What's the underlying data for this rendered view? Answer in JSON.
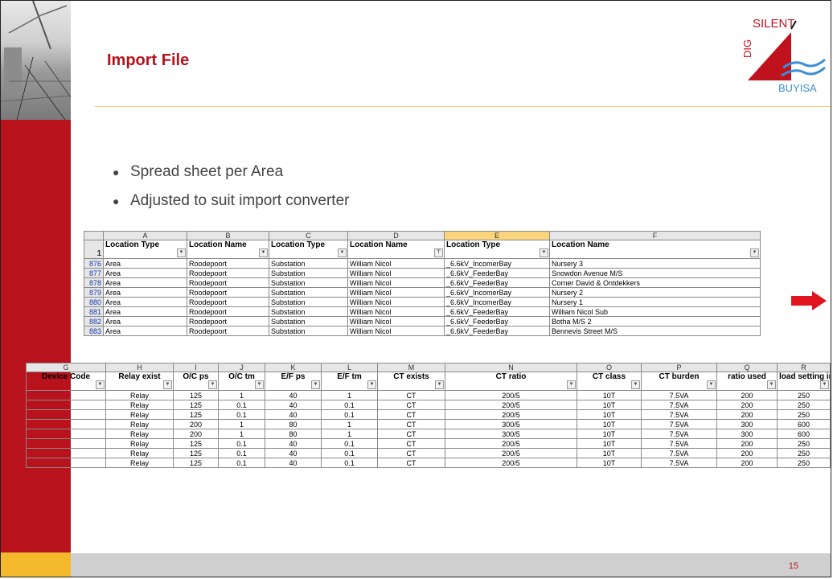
{
  "slide": {
    "title": "Import File",
    "page_number": "15",
    "bullets": [
      "Spread sheet per Area",
      "Adjusted to suit import converter"
    ]
  },
  "logo": {
    "top_text": "SILENT",
    "side_text": "DIG",
    "bottom_text": "BUYISA"
  },
  "sheet1": {
    "columns": [
      "A",
      "B",
      "C",
      "D",
      "E",
      "F"
    ],
    "header_row_number": "1",
    "headers": [
      "Location Type",
      "Location Name",
      "Location Type",
      "Location Name",
      "Location Type",
      "Location Name"
    ],
    "rows": [
      {
        "n": "876",
        "cells": [
          "Area",
          "Roodepoort",
          "Substation",
          "William Nicol",
          "_6.6kV_IncomerBay",
          "Nursery 3"
        ]
      },
      {
        "n": "877",
        "cells": [
          "Area",
          "Roodepoort",
          "Substation",
          "William Nicol",
          "_6.6kV_FeederBay",
          "Snowdon Avenue M/S"
        ]
      },
      {
        "n": "878",
        "cells": [
          "Area",
          "Roodepoort",
          "Substation",
          "William Nicol",
          "_6.6kV_FeederBay",
          "Corner David & Ontdekkers"
        ]
      },
      {
        "n": "879",
        "cells": [
          "Area",
          "Roodepoort",
          "Substation",
          "William Nicol",
          "_6.6kV_IncomerBay",
          "Nursery 2"
        ]
      },
      {
        "n": "880",
        "cells": [
          "Area",
          "Roodepoort",
          "Substation",
          "William Nicol",
          "_6.6kV_IncomerBay",
          "Nursery 1"
        ]
      },
      {
        "n": "881",
        "cells": [
          "Area",
          "Roodepoort",
          "Substation",
          "William Nicol",
          "_6.6kV_FeederBay",
          "William Nicol Sub"
        ]
      },
      {
        "n": "882",
        "cells": [
          "Area",
          "Roodepoort",
          "Substation",
          "William Nicol",
          "_6.6kV_FeederBay",
          "Botha M/S 2"
        ]
      },
      {
        "n": "883",
        "cells": [
          "Area",
          "Roodepoort",
          "Substation",
          "William Nicol",
          "_6.6kV_FeederBay",
          "Bennevis Street M/S"
        ]
      }
    ]
  },
  "sheet2": {
    "columns": [
      "G",
      "H",
      "I",
      "J",
      "K",
      "L",
      "M",
      "N",
      "O",
      "P",
      "Q",
      "R"
    ],
    "headers": [
      "Device Code",
      "Relay exist",
      "O/C ps",
      "O/C tm",
      "E/F ps",
      "E/F tm",
      "CT exists",
      "CT ratio",
      "CT class",
      "CT burden",
      "ratio used",
      "load setting in Amps"
    ],
    "rows": [
      [
        "",
        "Relay",
        "125",
        "1",
        "40",
        "1",
        "CT",
        "200/5",
        "10T",
        "7.5VA",
        "200",
        "250"
      ],
      [
        "",
        "Relay",
        "125",
        "0.1",
        "40",
        "0.1",
        "CT",
        "200/5",
        "10T",
        "7.5VA",
        "200",
        "250"
      ],
      [
        "",
        "Relay",
        "125",
        "0.1",
        "40",
        "0.1",
        "CT",
        "200/5",
        "10T",
        "7.5VA",
        "200",
        "250"
      ],
      [
        "",
        "Relay",
        "200",
        "1",
        "80",
        "1",
        "CT",
        "300/5",
        "10T",
        "7.5VA",
        "300",
        "600"
      ],
      [
        "",
        "Relay",
        "200",
        "1",
        "80",
        "1",
        "CT",
        "300/5",
        "10T",
        "7.5VA",
        "300",
        "600"
      ],
      [
        "",
        "Relay",
        "125",
        "0.1",
        "40",
        "0.1",
        "CT",
        "200/5",
        "10T",
        "7.5VA",
        "200",
        "250"
      ],
      [
        "",
        "Relay",
        "125",
        "0.1",
        "40",
        "0.1",
        "CT",
        "200/5",
        "10T",
        "7.5VA",
        "200",
        "250"
      ],
      [
        "",
        "Relay",
        "125",
        "0.1",
        "40",
        "0.1",
        "CT",
        "200/5",
        "10T",
        "7.5VA",
        "200",
        "250"
      ]
    ]
  },
  "colors": {
    "brand_red": "#b8121d",
    "accent_yellow": "#f3b82c",
    "arrow_red": "#e0141e"
  }
}
